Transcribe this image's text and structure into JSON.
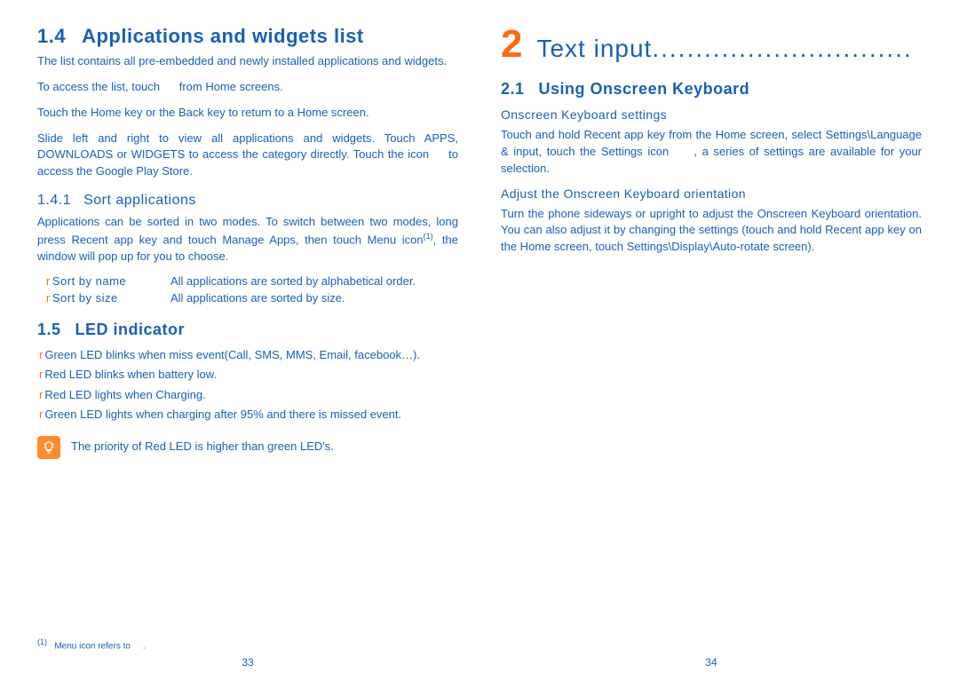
{
  "left": {
    "h2_num": "1.4",
    "h2_title": "Applications and widgets list",
    "p1": "The list contains all pre-embedded and newly installed applications and widgets.",
    "p2a": "To access the list, touch ",
    "p2b": " from Home screens.",
    "p3": "Touch the Home key or the Back key to return to a Home screen.",
    "p4": "Slide left and right to view all applications and widgets. Touch APPS, DOWNLOADS or WIDGETS to access the category directly. Touch the icon     to access the Google Play Store.",
    "h3_num": "1.4.1",
    "h3_title": "Sort applications",
    "p5a": "Applications can be sorted in two modes. To switch between two modes, long press Recent app key and touch Manage Apps, then touch Menu icon",
    "p5b": ", the window will pop up for you to choose.",
    "sort": [
      {
        "label": "Sort by name",
        "desc": "All applications are sorted by alphabetical order."
      },
      {
        "label": "Sort by size",
        "desc": "All applications are sorted by size."
      }
    ],
    "h2b_num": "1.5",
    "h2b_title": "LED indicator",
    "led": [
      "Green LED blinks when miss event(Call, SMS, MMS, Email, facebook…).",
      "Red LED blinks when battery low.",
      "Red LED lights when Charging.",
      "Green LED lights when charging after 95% and there is missed event."
    ],
    "note": "The priority of Red LED is higher than green LED's.",
    "footnote_marker": "(1)",
    "footnote": "Menu icon refers to     .",
    "page": "33"
  },
  "right": {
    "chapter_num": "2",
    "chapter_title": "Text input",
    "chapter_dots": "..............................",
    "h2_num": "2.1",
    "h2_title": "Using Onscreen Keyboard",
    "sub1": "Onscreen Keyboard settings",
    "p1": "Touch and hold Recent app key from the Home screen, select Settings\\Language & input, touch the Settings icon     , a series of settings are available for your selection.",
    "sub2": "Adjust the Onscreen Keyboard orientation",
    "p2": "Turn the phone sideways or upright to adjust the Onscreen Keyboard orientation. You can also adjust it by changing the settings (touch and hold Recent app key on the  Home screen, touch Settings\\Display\\Auto-rotate screen).",
    "page": "34"
  }
}
